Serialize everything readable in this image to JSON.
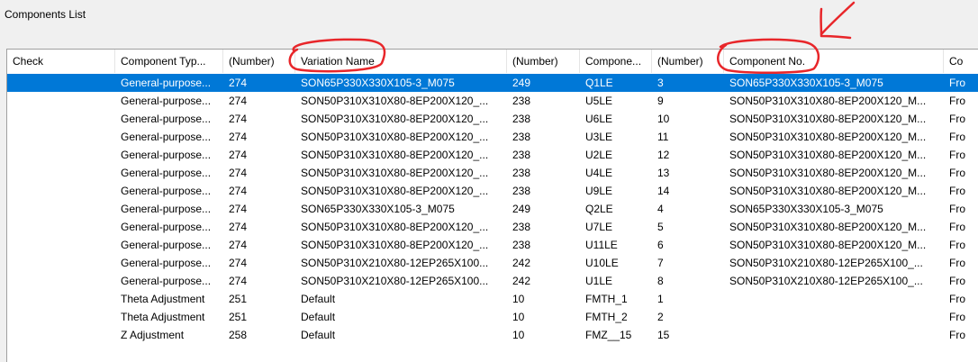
{
  "window": {
    "group_title": "Components List"
  },
  "columns": [
    "Check",
    "Component Typ...",
    "(Number)",
    "Variation Name",
    "(Number)",
    "Compone...",
    "(Number)",
    "Component No.",
    "Co"
  ],
  "rows": [
    {
      "selected": true,
      "cells": [
        "",
        "General-purpose...",
        "274",
        "SON65P330X330X105-3_M075",
        "249",
        "Q1LE",
        "3",
        "SON65P330X330X105-3_M075",
        "Fro"
      ]
    },
    {
      "selected": false,
      "cells": [
        "",
        "General-purpose...",
        "274",
        "SON50P310X310X80-8EP200X120_...",
        "238",
        "U5LE",
        "9",
        "SON50P310X310X80-8EP200X120_M...",
        "Fro"
      ]
    },
    {
      "selected": false,
      "cells": [
        "",
        "General-purpose...",
        "274",
        "SON50P310X310X80-8EP200X120_...",
        "238",
        "U6LE",
        "10",
        "SON50P310X310X80-8EP200X120_M...",
        "Fro"
      ]
    },
    {
      "selected": false,
      "cells": [
        "",
        "General-purpose...",
        "274",
        "SON50P310X310X80-8EP200X120_...",
        "238",
        "U3LE",
        "11",
        "SON50P310X310X80-8EP200X120_M...",
        "Fro"
      ]
    },
    {
      "selected": false,
      "cells": [
        "",
        "General-purpose...",
        "274",
        "SON50P310X310X80-8EP200X120_...",
        "238",
        "U2LE",
        "12",
        "SON50P310X310X80-8EP200X120_M...",
        "Fro"
      ]
    },
    {
      "selected": false,
      "cells": [
        "",
        "General-purpose...",
        "274",
        "SON50P310X310X80-8EP200X120_...",
        "238",
        "U4LE",
        "13",
        "SON50P310X310X80-8EP200X120_M...",
        "Fro"
      ]
    },
    {
      "selected": false,
      "cells": [
        "",
        "General-purpose...",
        "274",
        "SON50P310X310X80-8EP200X120_...",
        "238",
        "U9LE",
        "14",
        "SON50P310X310X80-8EP200X120_M...",
        "Fro"
      ]
    },
    {
      "selected": false,
      "cells": [
        "",
        "General-purpose...",
        "274",
        "SON65P330X330X105-3_M075",
        "249",
        "Q2LE",
        "4",
        "SON65P330X330X105-3_M075",
        "Fro"
      ]
    },
    {
      "selected": false,
      "cells": [
        "",
        "General-purpose...",
        "274",
        "SON50P310X310X80-8EP200X120_...",
        "238",
        "U7LE",
        "5",
        "SON50P310X310X80-8EP200X120_M...",
        "Fro"
      ]
    },
    {
      "selected": false,
      "cells": [
        "",
        "General-purpose...",
        "274",
        "SON50P310X310X80-8EP200X120_...",
        "238",
        "U11LE",
        "6",
        "SON50P310X310X80-8EP200X120_M...",
        "Fro"
      ]
    },
    {
      "selected": false,
      "cells": [
        "",
        "General-purpose...",
        "274",
        "SON50P310X210X80-12EP265X100...",
        "242",
        "U10LE",
        "7",
        "SON50P310X210X80-12EP265X100_...",
        "Fro"
      ]
    },
    {
      "selected": false,
      "cells": [
        "",
        "General-purpose...",
        "274",
        "SON50P310X210X80-12EP265X100...",
        "242",
        "U1LE",
        "8",
        "SON50P310X210X80-12EP265X100_...",
        "Fro"
      ]
    },
    {
      "selected": false,
      "cells": [
        "",
        "Theta Adjustment",
        "251",
        "Default",
        "10",
        "FMTH_1",
        "1",
        "",
        "Fro"
      ]
    },
    {
      "selected": false,
      "cells": [
        "",
        "Theta Adjustment",
        "251",
        "Default",
        "10",
        "FMTH_2",
        "2",
        "",
        "Fro"
      ]
    },
    {
      "selected": false,
      "cells": [
        "",
        "Z Adjustment",
        "258",
        "Default",
        "10",
        "FMZ__15",
        "15",
        "",
        "Fro"
      ]
    }
  ],
  "colors": {
    "selection": "#0078d7",
    "annotation": "#e8262a"
  }
}
